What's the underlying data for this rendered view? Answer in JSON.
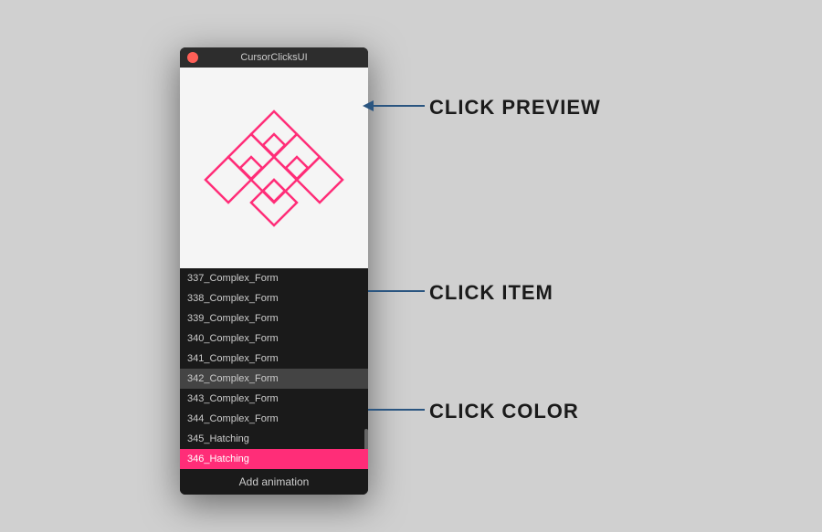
{
  "window": {
    "title": "CursorClicksUI",
    "traffic_light_color": "#ff5f57"
  },
  "labels": {
    "click_preview": "CLICK PREVIEW",
    "click_item": "CLICK ITEM",
    "click_color": "CLICK COLOR"
  },
  "list": {
    "items": [
      {
        "id": "337",
        "label": "337_Complex_Form",
        "selected": false,
        "color": false
      },
      {
        "id": "338",
        "label": "338_Complex_Form",
        "selected": false,
        "color": false
      },
      {
        "id": "339",
        "label": "339_Complex_Form",
        "selected": false,
        "color": false
      },
      {
        "id": "340",
        "label": "340_Complex_Form",
        "selected": false,
        "color": false
      },
      {
        "id": "341",
        "label": "341_Complex_Form",
        "selected": false,
        "color": false
      },
      {
        "id": "342",
        "label": "342_Complex_Form",
        "selected": true,
        "color": false
      },
      {
        "id": "343",
        "label": "343_Complex_Form",
        "selected": false,
        "color": false
      },
      {
        "id": "344",
        "label": "344_Complex_Form",
        "selected": false,
        "color": false
      },
      {
        "id": "345",
        "label": "345_Hatching",
        "selected": false,
        "color": false
      },
      {
        "id": "346",
        "label": "346_Hatching",
        "selected": false,
        "color": true
      }
    ],
    "add_button_label": "Add animation"
  },
  "preview": {
    "color": "#ff2d78"
  }
}
